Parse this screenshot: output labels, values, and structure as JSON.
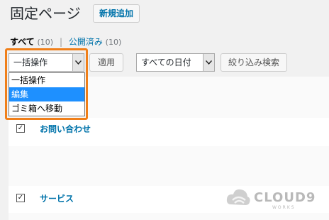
{
  "page": {
    "title": "固定ページ",
    "add_new_label": "新規追加"
  },
  "filters": {
    "all_label": "すべて",
    "all_count": "(10)",
    "separator": "|",
    "published_label": "公開済み",
    "published_count": "(10)"
  },
  "bulk_actions": {
    "selected": "一括操作",
    "options": [
      "一括操作",
      "編集",
      "ゴミ箱へ移動"
    ],
    "highlighted_option": "編集",
    "apply_label": "適用"
  },
  "date_filter": {
    "selected": "すべての日付",
    "filter_label": "絞り込み検索"
  },
  "rows": [
    {
      "title": "お問い合わせ",
      "checked": true
    },
    {
      "title": "サービス",
      "checked": true
    }
  ],
  "watermark": {
    "brand": "CLOUD9",
    "sub": "WORKS"
  },
  "colors": {
    "link": "#0073aa",
    "highlight": "#f07f19",
    "option_selected": "#1e90ff"
  }
}
